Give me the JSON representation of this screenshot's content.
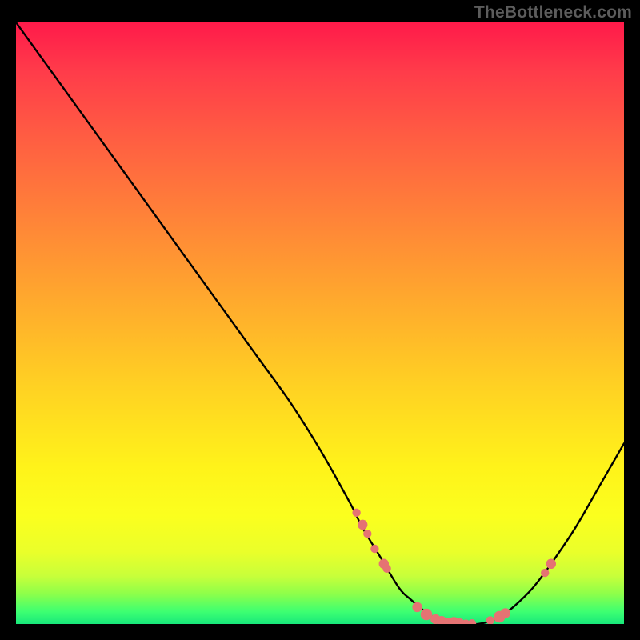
{
  "watermark": "TheBottleneck.com",
  "colors": {
    "background": "#000000",
    "curve": "#000000",
    "marker": "#e57373",
    "watermark": "#5c5c5c"
  },
  "chart_data": {
    "type": "line",
    "title": "",
    "xlabel": "",
    "ylabel": "",
    "xlim": [
      0,
      100
    ],
    "ylim": [
      0,
      100
    ],
    "series": [
      {
        "name": "bottleneck-curve",
        "x": [
          0,
          5,
          10,
          15,
          20,
          25,
          30,
          35,
          40,
          45,
          50,
          55,
          57,
          60,
          63,
          65,
          68,
          70,
          72,
          74,
          76,
          78,
          80,
          82,
          85,
          88,
          92,
          96,
          100
        ],
        "y": [
          100,
          93,
          86,
          79,
          72,
          65,
          58,
          51,
          44,
          37,
          29,
          20,
          16,
          11,
          6,
          4,
          1.5,
          0.7,
          0.3,
          0,
          0,
          0.5,
          1.5,
          3,
          6,
          10,
          16,
          23,
          30
        ]
      }
    ],
    "markers": [
      {
        "x": 56,
        "y": 18.5,
        "r": 1.0
      },
      {
        "x": 57,
        "y": 16.5,
        "r": 1.2
      },
      {
        "x": 57.8,
        "y": 15,
        "r": 1.0
      },
      {
        "x": 59,
        "y": 12.5,
        "r": 1.0
      },
      {
        "x": 60.5,
        "y": 10,
        "r": 1.2
      },
      {
        "x": 61,
        "y": 9.2,
        "r": 1.0
      },
      {
        "x": 66,
        "y": 2.8,
        "r": 1.2
      },
      {
        "x": 67.5,
        "y": 1.6,
        "r": 1.4
      },
      {
        "x": 69,
        "y": 0.8,
        "r": 1.2
      },
      {
        "x": 70,
        "y": 0.5,
        "r": 1.2
      },
      {
        "x": 71,
        "y": 0.3,
        "r": 1.0
      },
      {
        "x": 72,
        "y": 0.2,
        "r": 1.4
      },
      {
        "x": 73,
        "y": 0.1,
        "r": 1.2
      },
      {
        "x": 74,
        "y": 0.05,
        "r": 1.0
      },
      {
        "x": 75,
        "y": 0.1,
        "r": 1.0
      },
      {
        "x": 78,
        "y": 0.6,
        "r": 1.0
      },
      {
        "x": 79.5,
        "y": 1.2,
        "r": 1.4
      },
      {
        "x": 80.5,
        "y": 1.8,
        "r": 1.2
      },
      {
        "x": 87,
        "y": 8.5,
        "r": 1.0
      },
      {
        "x": 88,
        "y": 10,
        "r": 1.2
      }
    ],
    "gradient_stops": [
      {
        "pct": 0,
        "color": "#ff1a4a"
      },
      {
        "pct": 8,
        "color": "#ff3b4a"
      },
      {
        "pct": 18,
        "color": "#ff5a43"
      },
      {
        "pct": 30,
        "color": "#ff7c3a"
      },
      {
        "pct": 45,
        "color": "#ffa62e"
      },
      {
        "pct": 60,
        "color": "#ffd023"
      },
      {
        "pct": 74,
        "color": "#fff31a"
      },
      {
        "pct": 82,
        "color": "#fbff1e"
      },
      {
        "pct": 88,
        "color": "#eaff2a"
      },
      {
        "pct": 92,
        "color": "#c8ff3a"
      },
      {
        "pct": 95,
        "color": "#8dff4a"
      },
      {
        "pct": 98,
        "color": "#3cff72"
      },
      {
        "pct": 100,
        "color": "#18e87a"
      }
    ]
  }
}
